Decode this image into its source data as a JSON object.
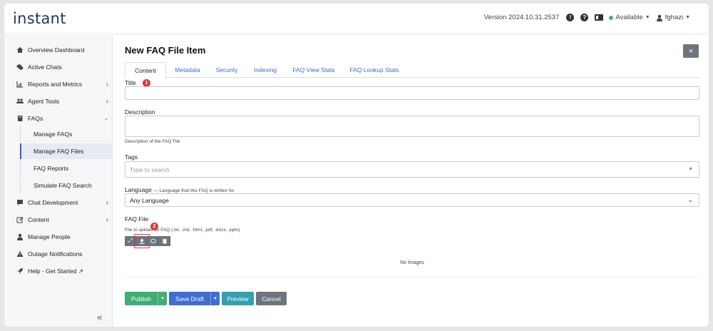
{
  "app": {
    "logo": "instant"
  },
  "header": {
    "version": "Version 2024.10.31.2537",
    "status": "Available",
    "user": "fghazi"
  },
  "sidebar": {
    "items": [
      {
        "label": "Overview Dashboard",
        "icon": "home-icon"
      },
      {
        "label": "Active Chats",
        "icon": "chat-icon"
      },
      {
        "label": "Reports and Metrics",
        "icon": "chart-icon"
      },
      {
        "label": "Agent Tools",
        "icon": "users-icon"
      },
      {
        "label": "FAQs",
        "icon": "book-icon"
      },
      {
        "label": "Chat Development",
        "icon": "bubble-icon"
      },
      {
        "label": "Content",
        "icon": "edit-icon"
      },
      {
        "label": "Manage People",
        "icon": "person-icon"
      },
      {
        "label": "Outage Notifications",
        "icon": "warning-icon"
      },
      {
        "label": "Help - Get Started ↗",
        "icon": "rocket-icon"
      }
    ],
    "faq_sub": [
      {
        "label": "Manage FAQs"
      },
      {
        "label": "Manage FAQ Files"
      },
      {
        "label": "FAQ Reports"
      },
      {
        "label": "Simulate FAQ Search"
      }
    ],
    "active_sub": "Manage FAQ Files"
  },
  "main": {
    "title": "New FAQ File Item",
    "close_label": "×",
    "tabs": [
      {
        "label": "Content"
      },
      {
        "label": "Metadata"
      },
      {
        "label": "Security"
      },
      {
        "label": "Indexing"
      },
      {
        "label": "FAQ View Stats"
      },
      {
        "label": "FAQ Lookup Stats"
      }
    ],
    "form": {
      "title_label": "Title",
      "title_value": "",
      "description_label": "Description",
      "description_value": "",
      "description_help": "Description of the FAQ File",
      "tags_label": "Tags",
      "tags_placeholder": "Type to search",
      "language_label": "Language",
      "language_hint": "— Language that this FAQ is written for",
      "language_value": "Any Language",
      "faq_file_label": "FAQ File",
      "faq_file_help": "File to upload for FAQ (.txt, .md, .html, .pdf, .docx, .pptx)",
      "no_images": "No Images"
    },
    "annotations": {
      "one": "1",
      "two": "2"
    },
    "actions": {
      "publish": "Publish",
      "save_draft": "Save Draft",
      "preview": "Preview",
      "cancel": "Cancel"
    }
  },
  "colors": {
    "publish": "#3fae75",
    "save_draft": "#3f6ed0",
    "preview": "#33a0b0",
    "cancel": "#6c757d",
    "tab_link": "#3a6fc4",
    "badge": "#d93b3b"
  }
}
